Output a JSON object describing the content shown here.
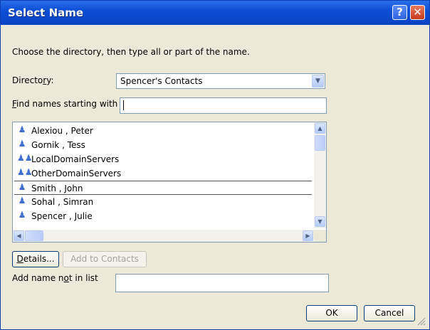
{
  "window": {
    "title": "Select Name",
    "help_label": "?",
    "close_label": "✕"
  },
  "dialog": {
    "instruction": "Choose the directory, then type all or part of the name.",
    "directory": {
      "label_pre": "Directo",
      "label_u": "r",
      "label_post": "y:",
      "selected": "Spencer's Contacts"
    },
    "find": {
      "label_u": "F",
      "label_post": "ind names starting with",
      "value": ""
    },
    "names": [
      {
        "name": "Alexiou , Peter",
        "icon": "person-icon",
        "selected": false
      },
      {
        "name": "Gornik , Tess",
        "icon": "person-icon",
        "selected": false
      },
      {
        "name": "LocalDomainServers",
        "icon": "group-icon",
        "selected": false
      },
      {
        "name": "OtherDomainServers",
        "icon": "group-icon",
        "selected": false
      },
      {
        "name": "Smith , John",
        "icon": "person-icon",
        "selected": true
      },
      {
        "name": "Sohal , Simran",
        "icon": "person-icon",
        "selected": false
      },
      {
        "name": "Spencer , Julie",
        "icon": "person-icon",
        "selected": false
      }
    ],
    "details_u": "D",
    "details_post": "etails...",
    "add_to_contacts": "Add to Contacts",
    "add_name": {
      "label_pre": "Add name n",
      "label_u": "o",
      "label_post": "t in list",
      "value": ""
    },
    "ok": "OK",
    "cancel": "Cancel"
  },
  "colors": {
    "titlebar": "#0a43c4",
    "dialog_bg": "#ece9d8",
    "field_border": "#7f9db9",
    "icon_blue": "#3f6fd1"
  }
}
